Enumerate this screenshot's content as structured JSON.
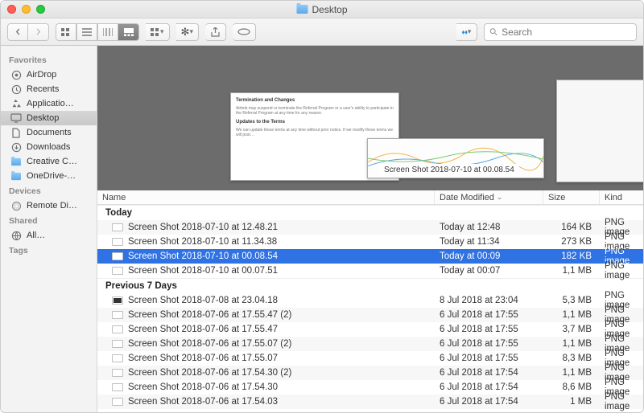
{
  "window": {
    "title": "Desktop"
  },
  "search": {
    "placeholder": "Search"
  },
  "sidebar": {
    "sections": [
      {
        "title": "Favorites",
        "items": [
          {
            "label": "AirDrop",
            "icon": "airdrop"
          },
          {
            "label": "Recents",
            "icon": "clock"
          },
          {
            "label": "Applicatio…",
            "icon": "apps"
          },
          {
            "label": "Desktop",
            "icon": "desktop",
            "active": true
          },
          {
            "label": "Documents",
            "icon": "documents"
          },
          {
            "label": "Downloads",
            "icon": "downloads"
          },
          {
            "label": "Creative C…",
            "icon": "folder"
          },
          {
            "label": "OneDrive-…",
            "icon": "folder"
          }
        ]
      },
      {
        "title": "Devices",
        "items": [
          {
            "label": "Remote Di…",
            "icon": "disk"
          }
        ]
      },
      {
        "title": "Shared",
        "items": [
          {
            "label": "All…",
            "icon": "globe"
          }
        ]
      },
      {
        "title": "Tags",
        "items": []
      }
    ]
  },
  "preview_label": "Screen Shot 2018-07-10 at 00.08.54",
  "columns": {
    "name": "Name",
    "date": "Date Modified",
    "size": "Size",
    "kind": "Kind"
  },
  "groups": [
    {
      "title": "Today",
      "rows": [
        {
          "name": "Screen Shot 2018-07-10 at 12.48.21",
          "date": "Today at 12:48",
          "size": "164 KB",
          "kind": "PNG image"
        },
        {
          "name": "Screen Shot 2018-07-10 at 11.34.38",
          "date": "Today at 11:34",
          "size": "273 KB",
          "kind": "PNG image"
        },
        {
          "name": "Screen Shot 2018-07-10 at 00.08.54",
          "date": "Today at 00:09",
          "size": "182 KB",
          "kind": "PNG image",
          "selected": true
        },
        {
          "name": "Screen Shot 2018-07-10 at 00.07.51",
          "date": "Today at 00:07",
          "size": "1,1 MB",
          "kind": "PNG image"
        }
      ]
    },
    {
      "title": "Previous 7 Days",
      "rows": [
        {
          "name": "Screen Shot 2018-07-08 at 23.04.18",
          "date": "8 Jul 2018 at 23:04",
          "size": "5,3 MB",
          "kind": "PNG image",
          "dark": true
        },
        {
          "name": "Screen Shot 2018-07-06 at 17.55.47 (2)",
          "date": "6 Jul 2018 at 17:55",
          "size": "1,1 MB",
          "kind": "PNG image"
        },
        {
          "name": "Screen Shot 2018-07-06 at 17.55.47",
          "date": "6 Jul 2018 at 17:55",
          "size": "3,7 MB",
          "kind": "PNG image"
        },
        {
          "name": "Screen Shot 2018-07-06 at 17.55.07 (2)",
          "date": "6 Jul 2018 at 17:55",
          "size": "1,1 MB",
          "kind": "PNG image"
        },
        {
          "name": "Screen Shot 2018-07-06 at 17.55.07",
          "date": "6 Jul 2018 at 17:55",
          "size": "8,3 MB",
          "kind": "PNG image"
        },
        {
          "name": "Screen Shot 2018-07-06 at 17.54.30 (2)",
          "date": "6 Jul 2018 at 17:54",
          "size": "1,1 MB",
          "kind": "PNG image"
        },
        {
          "name": "Screen Shot 2018-07-06 at 17.54.30",
          "date": "6 Jul 2018 at 17:54",
          "size": "8,6 MB",
          "kind": "PNG image"
        },
        {
          "name": "Screen Shot 2018-07-06 at 17.54.03",
          "date": "6 Jul 2018 at 17:54",
          "size": "1 MB",
          "kind": "PNG image"
        }
      ]
    }
  ]
}
